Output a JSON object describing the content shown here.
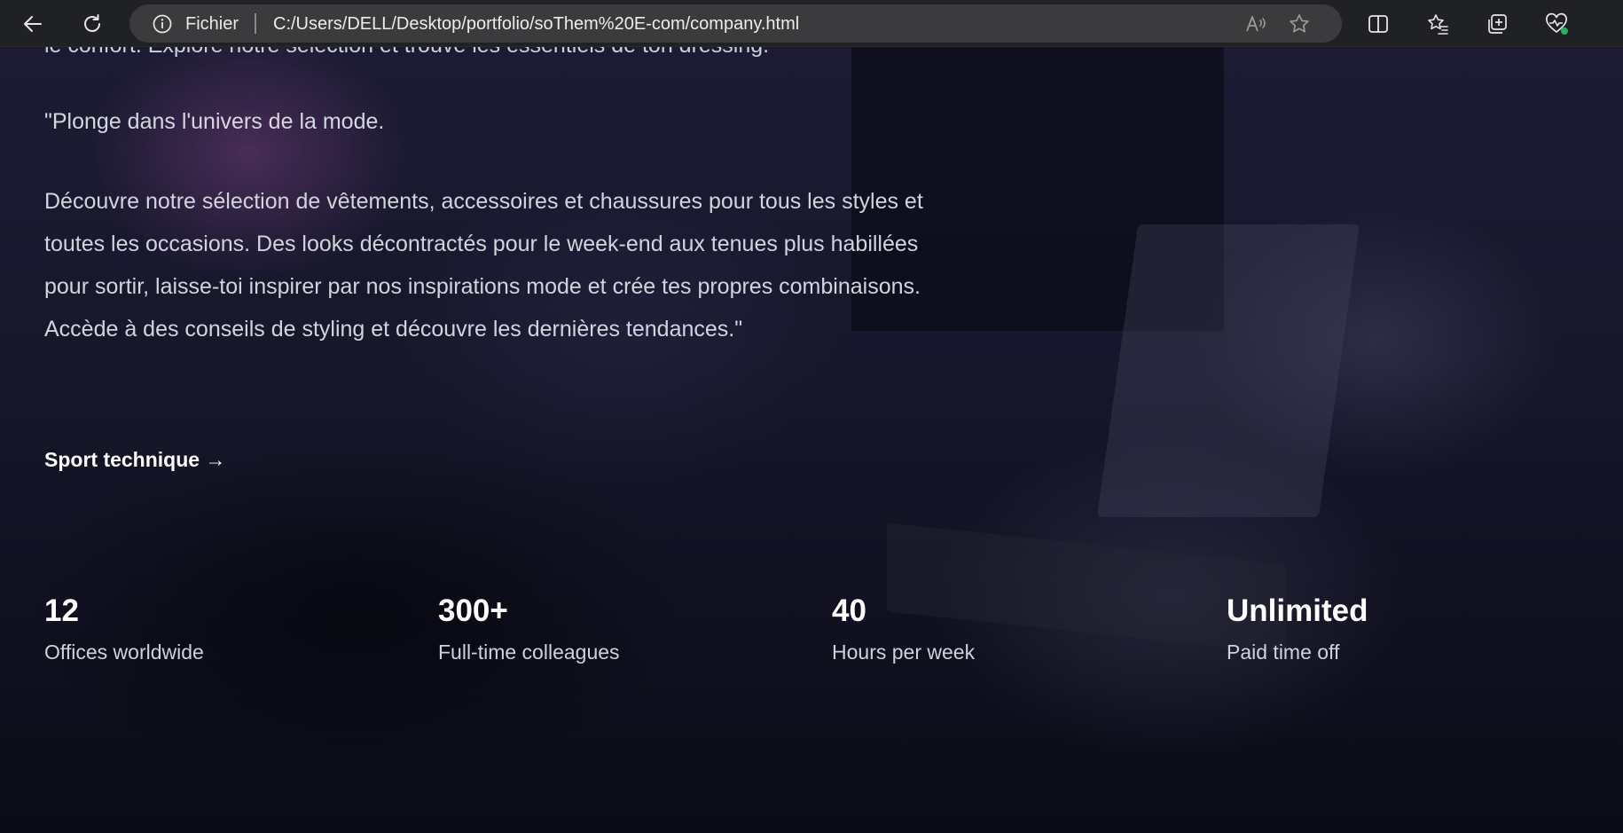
{
  "browser": {
    "site_label": "Fichier",
    "url": "C:/Users/DELL/Desktop/portfolio/soThem%20E-com/company.html",
    "icons": [
      "back-arrow-icon",
      "refresh-icon",
      "info-icon",
      "read-aloud-icon",
      "favorite-star-icon",
      "split-screen-icon",
      "favorites-icon",
      "collections-icon",
      "browser-essentials-icon"
    ]
  },
  "hero": {
    "intro_cut": "le confort. Explore notre sélection et trouve les essentiels de ton dressing.",
    "quote_title": "\"Plonge dans l'univers de la mode.",
    "description": "Découvre notre sélection de vêtements, accessoires et chaussures pour tous les styles et toutes les occasions. Des looks décontractés pour le week-end aux tenues plus habillées pour sortir, laisse-toi inspirer par nos inspirations mode et crée tes propres combinaisons. Accède à des conseils de styling et découvre les dernières tendances.\"",
    "cta": "Sport technique →"
  },
  "stats": [
    {
      "value": "12",
      "label": "Offices worldwide"
    },
    {
      "value": "300+",
      "label": "Full-time colleagues"
    },
    {
      "value": "40",
      "label": "Hours per week"
    },
    {
      "value": "Unlimited",
      "label": "Paid time off"
    }
  ],
  "colors": {
    "toolbar_bg": "#202124",
    "addressbar_bg": "#3b3b3d",
    "page_bg": "#17172b",
    "text_primary": "#ffffff",
    "text_secondary": "#d2d4dc",
    "status_dot": "#1db954"
  }
}
